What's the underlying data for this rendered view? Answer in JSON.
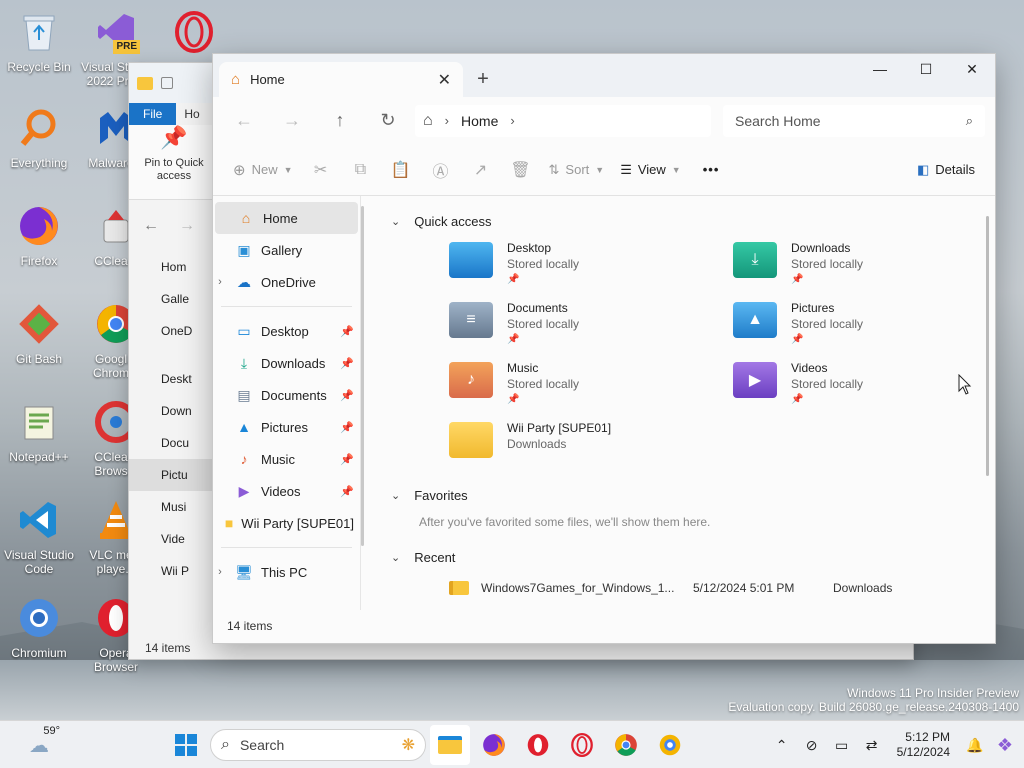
{
  "desktop": {
    "icons": [
      {
        "label": "Recycle Bin",
        "icon": "recycle-bin-icon"
      },
      {
        "label": "Visual Studio 2022 Pre...",
        "icon": "visual-studio-preview-icon",
        "badge": "PRE"
      },
      {
        "label": "Opera GX",
        "icon": "opera-gx-icon"
      },
      {
        "label": "Everything",
        "icon": "everything-search-icon"
      },
      {
        "label": "Malware...",
        "icon": "malwarebytes-icon"
      },
      {
        "label": "Firefox",
        "icon": "firefox-icon"
      },
      {
        "label": "CClea...",
        "icon": "ccleaner-icon"
      },
      {
        "label": "Git Bash",
        "icon": "git-bash-icon"
      },
      {
        "label": "Googl... Chrom...",
        "icon": "chrome-icon"
      },
      {
        "label": "Notepad++",
        "icon": "notepad-plus-plus-icon"
      },
      {
        "label": "CClea... Brows...",
        "icon": "ccleaner-browser-icon"
      },
      {
        "label": "Visual Studio Code",
        "icon": "vscode-icon"
      },
      {
        "label": "VLC me... playe...",
        "icon": "vlc-icon"
      },
      {
        "label": "Chromium",
        "icon": "chromium-icon"
      },
      {
        "label": "Opera Browser",
        "icon": "opera-icon"
      }
    ]
  },
  "back_window": {
    "ribbon_tabs": {
      "file": "File",
      "home": "Ho"
    },
    "pin_label": "Pin to Quick access",
    "sidebar": [
      "Hom",
      "Galle",
      "OneD",
      "Deskt",
      "Down",
      "Docu",
      "Pictu",
      "Musi",
      "Vide",
      "Wii P"
    ],
    "status": "14 items"
  },
  "window": {
    "tab_title": "Home",
    "new_tab": "+",
    "controls": {
      "minimize": "—",
      "maximize": "☐",
      "close": "✕"
    },
    "breadcrumb": {
      "location": "Home"
    },
    "search_placeholder": "Search Home",
    "commands": {
      "new": "New",
      "sort": "Sort",
      "view": "View",
      "more": "•••",
      "details": "Details"
    },
    "sidebar": {
      "home": "Home",
      "gallery": "Gallery",
      "onedrive": "OneDrive",
      "pinned": [
        {
          "label": "Desktop",
          "icon": "desktop-folder-icon",
          "pinned": true
        },
        {
          "label": "Downloads",
          "icon": "download-arrow-icon",
          "pinned": true
        },
        {
          "label": "Documents",
          "icon": "documents-icon",
          "pinned": true
        },
        {
          "label": "Pictures",
          "icon": "pictures-icon",
          "pinned": true
        },
        {
          "label": "Music",
          "icon": "music-icon",
          "pinned": true
        },
        {
          "label": "Videos",
          "icon": "videos-icon",
          "pinned": true
        },
        {
          "label": "Wii Party [SUPE01]",
          "icon": "folder-icon",
          "pinned": false
        }
      ],
      "this_pc": "This PC"
    },
    "quick_access": {
      "heading": "Quick access",
      "items": [
        {
          "name": "Desktop",
          "sub": "Stored locally",
          "icon": "desktop-folder-icon",
          "pinned": true
        },
        {
          "name": "Downloads",
          "sub": "Stored locally",
          "icon": "downloads-folder-icon",
          "pinned": true
        },
        {
          "name": "Documents",
          "sub": "Stored locally",
          "icon": "documents-folder-icon",
          "pinned": true
        },
        {
          "name": "Pictures",
          "sub": "Stored locally",
          "icon": "pictures-folder-icon",
          "pinned": true
        },
        {
          "name": "Music",
          "sub": "Stored locally",
          "icon": "music-folder-icon",
          "pinned": true
        },
        {
          "name": "Videos",
          "sub": "Stored locally",
          "icon": "videos-folder-icon",
          "pinned": true
        },
        {
          "name": "Wii Party [SUPE01]",
          "sub": "Downloads",
          "icon": "folder-icon",
          "pinned": false
        }
      ]
    },
    "favorites": {
      "heading": "Favorites",
      "note": "After you've favorited some files, we'll show them here."
    },
    "recent": {
      "heading": "Recent",
      "rows": [
        {
          "name": "Windows7Games_for_Windows_1...",
          "date": "5/12/2024 5:01 PM",
          "location": "Downloads"
        }
      ]
    },
    "status": "14 items"
  },
  "watermark": {
    "line1": "Windows 11 Pro Insider Preview",
    "line2": "Evaluation copy. Build 26080.ge_release.240308-1400"
  },
  "taskbar": {
    "weather_temp": "59°",
    "search_label": "Search",
    "apps": [
      "file-explorer-icon",
      "firefox-icon",
      "opera-icon",
      "opera-gx-icon",
      "chrome-icon",
      "chromium-icon"
    ],
    "time": "5:12 PM",
    "date": "5/12/2024"
  },
  "colors": {
    "accent": "#1a73c7",
    "folder_yellow": "#f8c63d",
    "folder_blue": "#2a8fd6",
    "folder_teal": "#1aa58a"
  }
}
